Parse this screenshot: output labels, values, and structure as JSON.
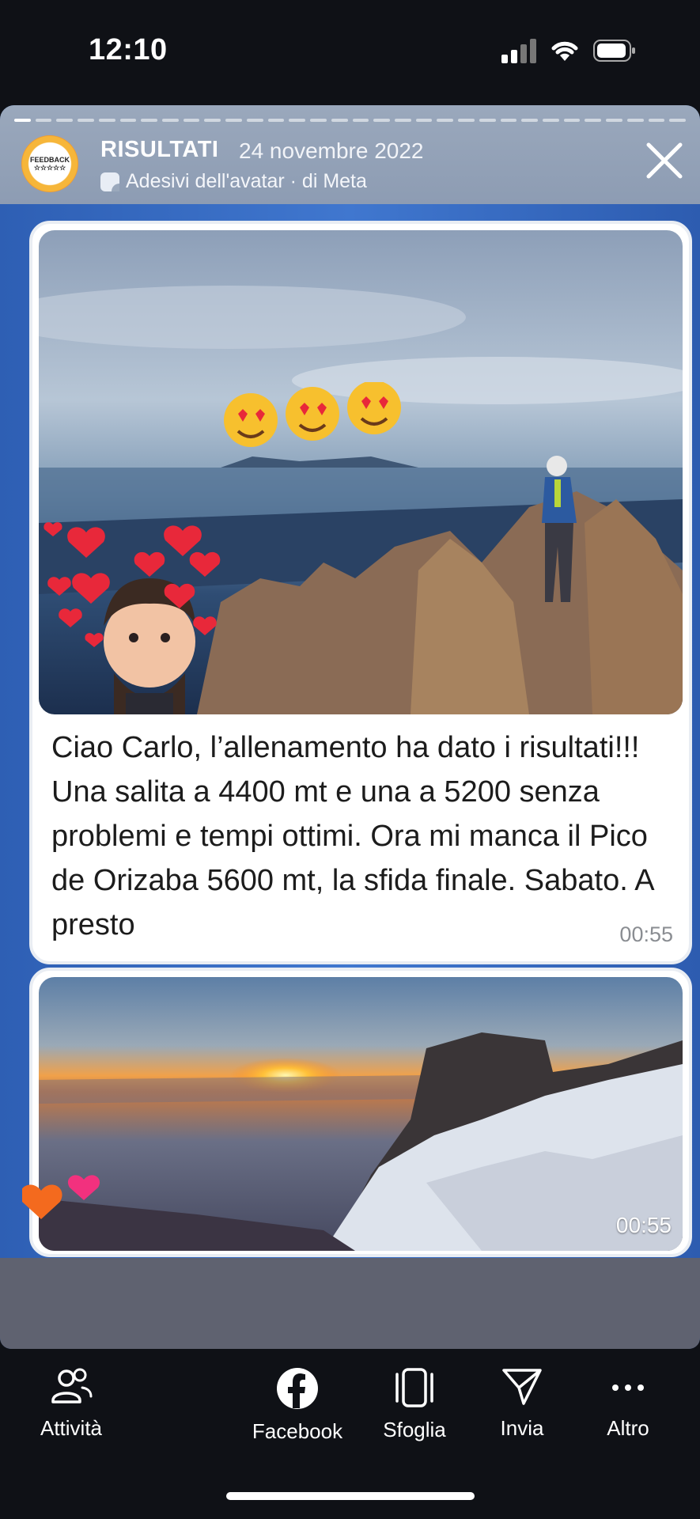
{
  "status_bar": {
    "time": "12:10"
  },
  "story": {
    "page_name": "RISULTATI",
    "date": "24 novembre 2022",
    "sticker_credit": "Adesivi dell'avatar · di Meta",
    "avatar_text": "FEEDBACK ☆☆☆☆☆"
  },
  "messages": [
    {
      "text": "Ciao Carlo, l’allenamento ha dato i risultati!!! Una salita a 4400 mt e una a 5200 senza problemi e tempi ottimi. Ora mi manca il Pico de Orizaba 5600 mt, la sfida finale. Sabato. A presto",
      "time": "00:55"
    },
    {
      "time": "00:55"
    }
  ],
  "bottom_nav": [
    {
      "label": "Attività",
      "icon": "people-icon"
    },
    {
      "label": "Facebook",
      "icon": "facebook-icon"
    },
    {
      "label": "Sfoglia",
      "icon": "swipe-icon"
    },
    {
      "label": "Invia",
      "icon": "send-icon"
    },
    {
      "label": "Altro",
      "icon": "more-icon"
    }
  ],
  "colors": {
    "accent_heart": "#e8283a",
    "story_bg": "#3a6cc4",
    "header_bg": "#95a3b8"
  }
}
